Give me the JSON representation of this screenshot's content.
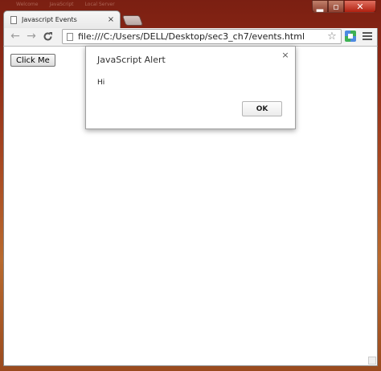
{
  "window": {
    "background_tabs": [
      "Welcome",
      "JavaScript",
      "Local Server"
    ],
    "minimize_glyph": "▂",
    "maximize_glyph": "▫",
    "close_glyph": "✕"
  },
  "tab": {
    "title": "Javascript Events",
    "close_glyph": "×",
    "icon": "page-icon"
  },
  "toolbar": {
    "back_glyph": "←",
    "forward_glyph": "→",
    "reload_glyph": "C",
    "url": "file:///C:/Users/DELL/Desktop/sec3_ch7/events.html",
    "star_glyph": "☆",
    "extension_icon": "drive-extension-icon",
    "menu_icon": "hamburger-menu-icon"
  },
  "page": {
    "button_label": "Click Me"
  },
  "alert": {
    "title": "JavaScript Alert",
    "close_glyph": "×",
    "message": "Hi",
    "ok_label": "OK"
  },
  "colors": {
    "frame": "#8e2a16",
    "toolbar": "#f2f2f2",
    "page": "#ffffff"
  }
}
